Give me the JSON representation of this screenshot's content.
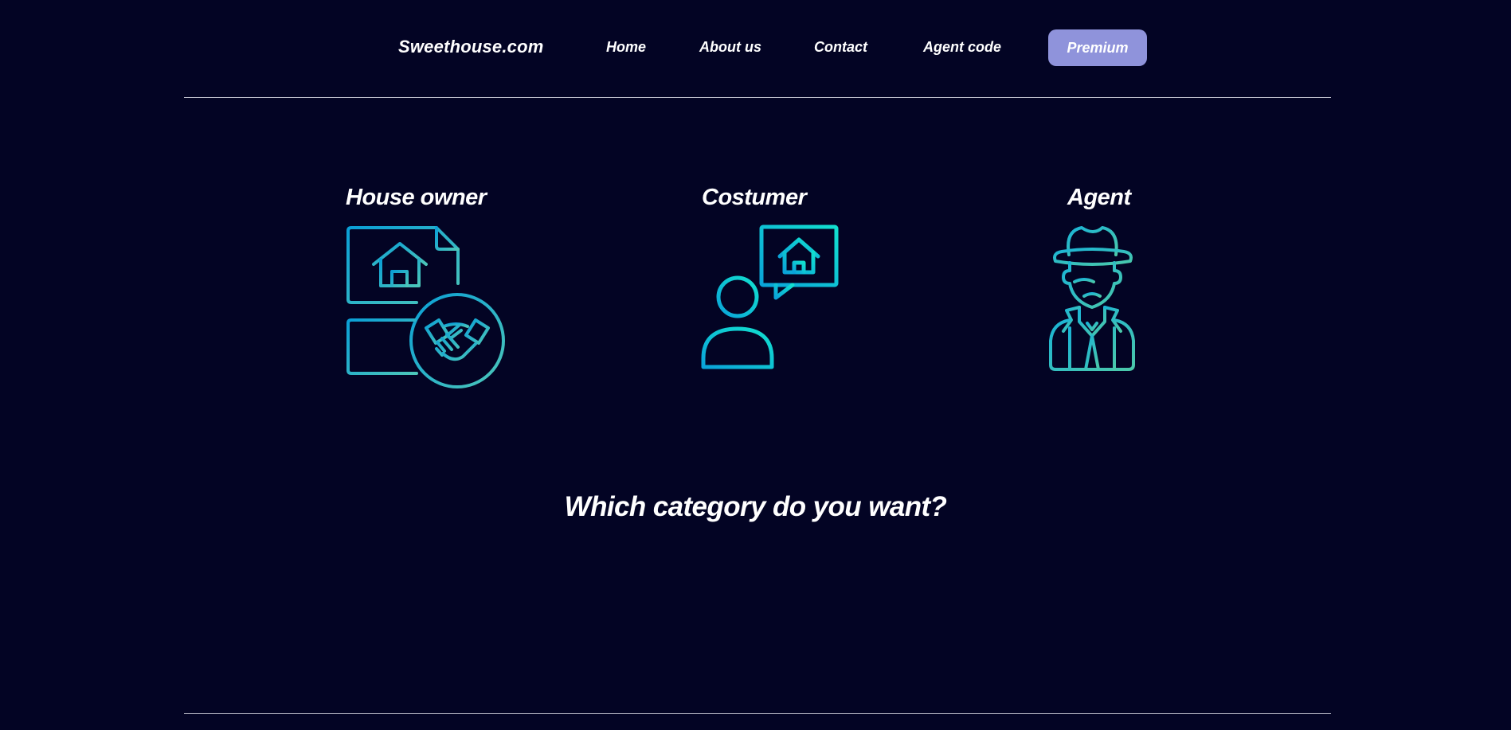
{
  "nav": {
    "brand": "Sweethouse.com",
    "links": [
      {
        "label": "Home"
      },
      {
        "label": "About us"
      },
      {
        "label": "Contact"
      },
      {
        "label": "Agent code"
      }
    ],
    "premium_label": "Premium"
  },
  "categories": [
    {
      "title": "House owner",
      "icon": "contract-handshake-icon"
    },
    {
      "title": "Costumer",
      "icon": "user-speech-house-icon"
    },
    {
      "title": "Agent",
      "icon": "detective-agent-icon"
    }
  ],
  "question": "Which category do you want?",
  "colors": {
    "background": "#030424",
    "premium": "#8f93db",
    "icon_gradient_start": "#0aa9d8",
    "icon_gradient_end": "#12d9c9",
    "divider": "#bfc0cc"
  }
}
